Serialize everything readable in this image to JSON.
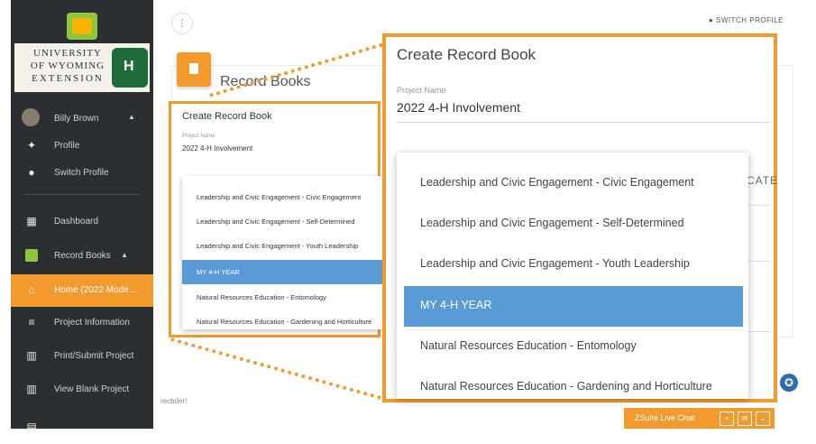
{
  "sidebar": {
    "university_lines": [
      "UNIVERSITY",
      "OF WYOMING",
      "EXTENSION"
    ],
    "user_name": "Billy Brown",
    "items": [
      {
        "label": "Profile",
        "icon": "person-icon"
      },
      {
        "label": "Switch Profile",
        "icon": "switch-user-icon"
      },
      {
        "label": "Dashboard",
        "icon": "dashboard-icon"
      },
      {
        "label": "Record Books",
        "icon": "record-books-icon"
      },
      {
        "label": "Home (2022 Mode...",
        "icon": "home-icon"
      },
      {
        "label": "Project Information",
        "icon": "list-icon"
      },
      {
        "label": "Print/Submit Project",
        "icon": "print-icon"
      },
      {
        "label": "View Blank Project",
        "icon": "table-icon"
      }
    ]
  },
  "header": {
    "menu_glyph": "⋮",
    "switch_profile": "SWITCH PROFILE"
  },
  "record_books": {
    "title": "Record Books"
  },
  "small_panel": {
    "title": "Create Record Book",
    "project_label": "Project Name",
    "project_value": "2022 4-H Involvement",
    "options": [
      "Leadership and Civic Engagement - Civic Engagement",
      "Leadership and Civic Engagement - Self-Determined",
      "Leadership and Civic Engagement - Youth Leadership",
      "MY 4-H YEAR",
      "Natural Resources Education - Entomology",
      "Natural Resources Education - Gardening and Horticulture"
    ],
    "selected": "MY 4-H YEAR"
  },
  "big_panel": {
    "title": "Create Record Book",
    "project_label": "Project Name",
    "project_value": "2022 4-H Involvement",
    "cate_text": "CATE",
    "options": [
      "Leadership and Civic Engagement - Civic Engagement",
      "Leadership and Civic Engagement - Self-Determined",
      "Leadership and Civic Engagement - Youth Leadership",
      "MY 4-H YEAR",
      "Natural Resources Education - Entomology",
      "Natural Resources Education - Gardening and Horticulture"
    ],
    "selected": "MY 4-H YEAR"
  },
  "footer": {
    "text": "recbder!"
  },
  "chat": {
    "label": "ZSuite Live Chat"
  },
  "colors": {
    "accent": "#f39a2e",
    "selected": "#5b9bd5",
    "sidebar": "#2c2f31"
  }
}
